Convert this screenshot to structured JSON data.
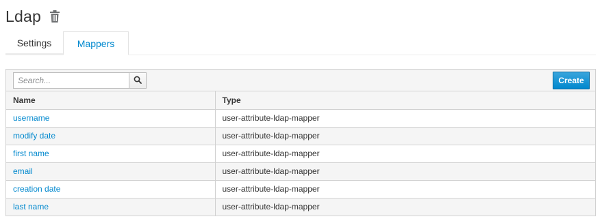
{
  "header": {
    "title": "Ldap",
    "delete_icon": "trash-icon"
  },
  "tabs": [
    {
      "label": "Settings",
      "active": false
    },
    {
      "label": "Mappers",
      "active": true
    }
  ],
  "toolbar": {
    "search_placeholder": "Search...",
    "search_icon": "search-icon",
    "create_label": "Create"
  },
  "table": {
    "columns": [
      "Name",
      "Type"
    ],
    "rows": [
      {
        "name": "username",
        "type": "user-attribute-ldap-mapper"
      },
      {
        "name": "modify date",
        "type": "user-attribute-ldap-mapper"
      },
      {
        "name": "first name",
        "type": "user-attribute-ldap-mapper"
      },
      {
        "name": "email",
        "type": "user-attribute-ldap-mapper"
      },
      {
        "name": "creation date",
        "type": "user-attribute-ldap-mapper"
      },
      {
        "name": "last name",
        "type": "user-attribute-ldap-mapper"
      }
    ]
  },
  "colors": {
    "accent": "#0088ce",
    "border": "#d1d1d1",
    "stripe": "#f5f5f5"
  }
}
